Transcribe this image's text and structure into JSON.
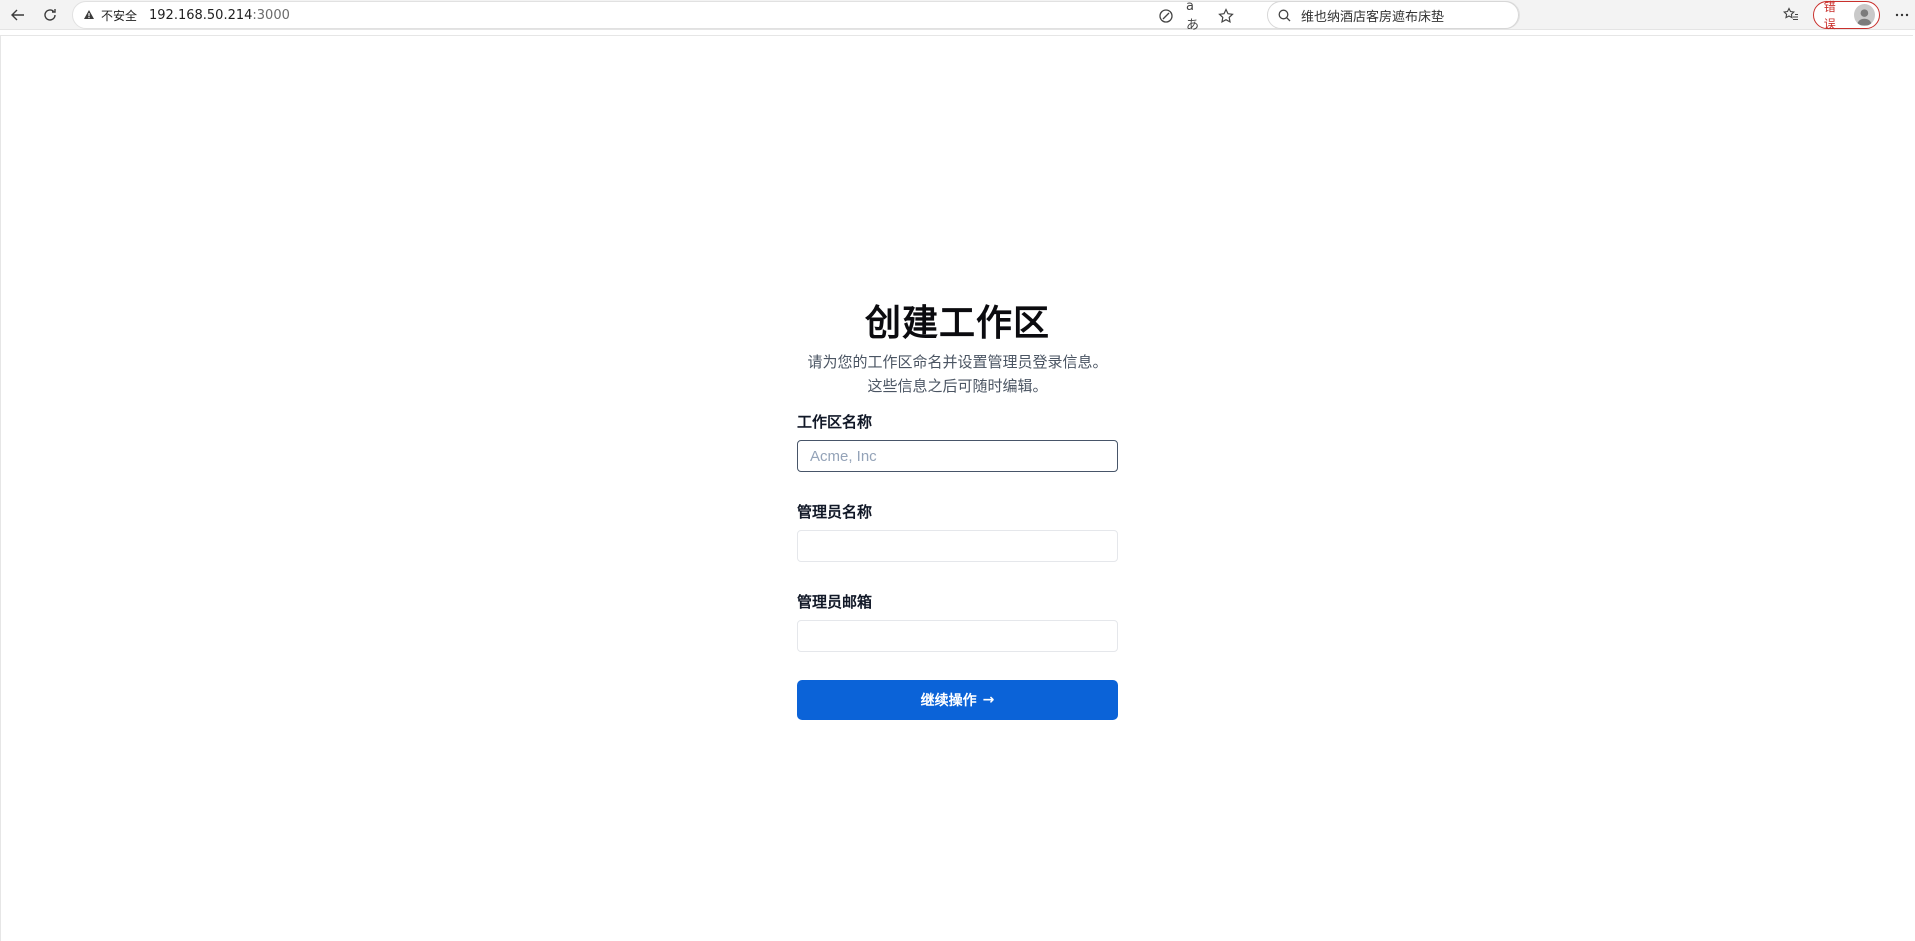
{
  "browser": {
    "security_label": "不安全",
    "url_host": "192.168.50.214",
    "url_port": ":3000",
    "search_text": "维也纳酒店客房遮布床垫",
    "error_label": "错误",
    "translate_icon_text": "aあ"
  },
  "form": {
    "title": "创建工作区",
    "subtitle_line1": "请为您的工作区命名并设置管理员登录信息。",
    "subtitle_line2": "这些信息之后可随时编辑。",
    "workspace_label": "工作区名称",
    "workspace_placeholder": "Acme, Inc",
    "workspace_value": "",
    "admin_name_label": "管理员名称",
    "admin_name_value": "",
    "admin_email_label": "管理员邮箱",
    "admin_email_value": "",
    "continue_label": "继续操作",
    "continue_arrow": "→"
  },
  "colors": {
    "primary": "#0b63d8",
    "error": "#c9302c"
  }
}
